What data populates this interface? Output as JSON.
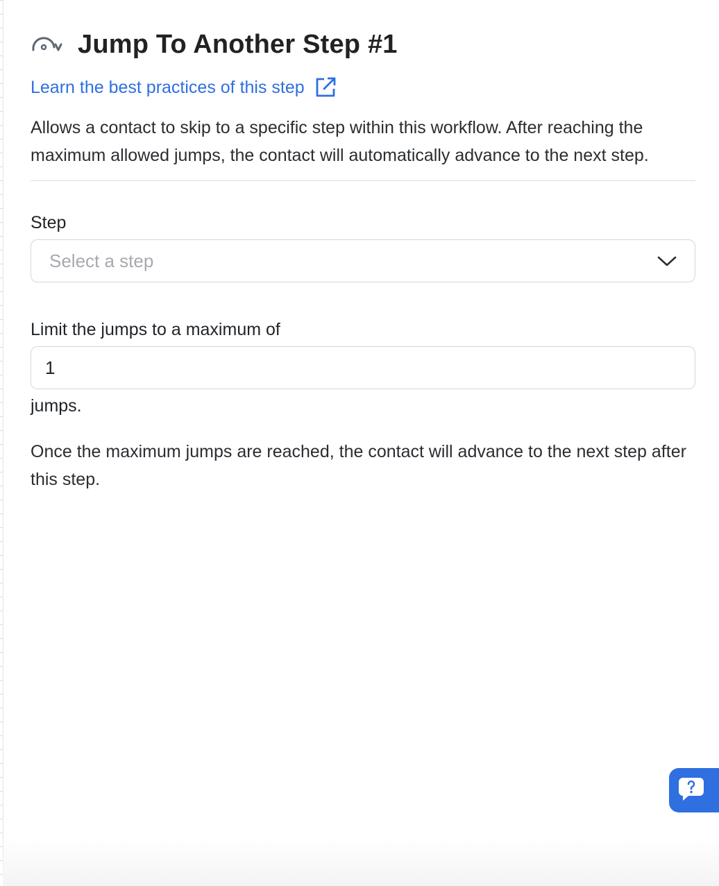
{
  "header": {
    "icon": "jump-arrow-icon",
    "title": "Jump To Another Step #1"
  },
  "learn_link": {
    "label": "Learn the best practices of this step",
    "icon": "external-link-icon"
  },
  "description": "Allows a contact to skip to a specific step within this workflow. After reaching the maximum allowed jumps, the contact will automatically advance to the next step.",
  "step_field": {
    "label": "Step",
    "placeholder": "Select a step",
    "icon": "chevron-down-icon"
  },
  "limit_field": {
    "label": "Limit the jumps to a maximum of",
    "value": "1",
    "suffix": "jumps."
  },
  "note": "Once the maximum jumps are reached, the contact will advance to the next step after this step.",
  "help": {
    "icon": "help-chat-icon"
  },
  "colors": {
    "accent": "#2f6fe0",
    "border": "#d3d6db",
    "text": "#1f2328",
    "placeholder": "#a6a9ae"
  }
}
